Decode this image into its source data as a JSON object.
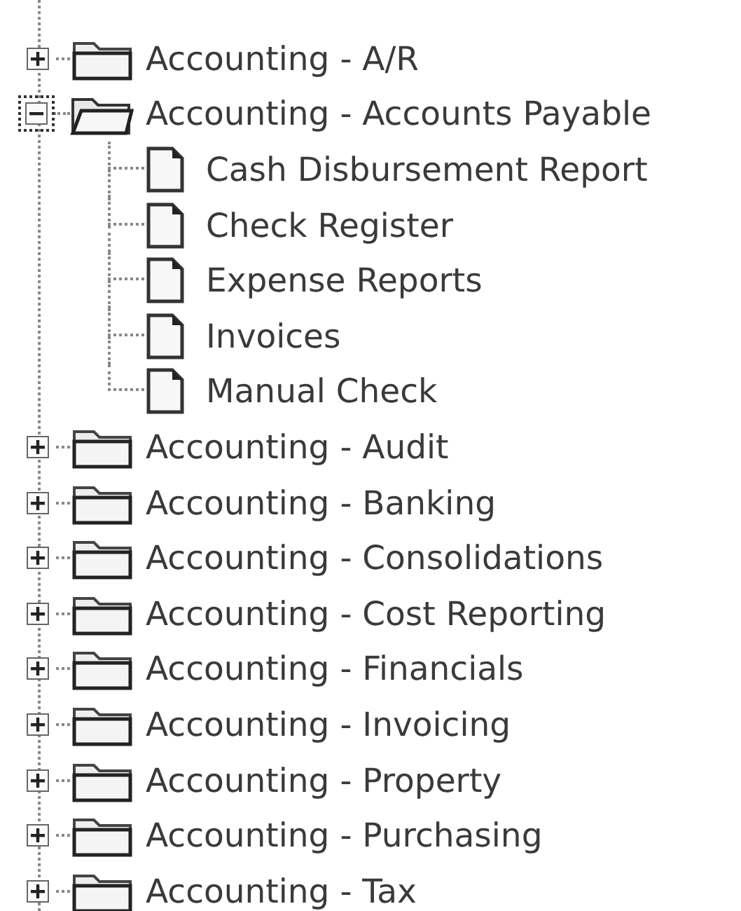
{
  "folders": [
    {
      "label": "Accounting - A/R",
      "expanded": false,
      "focused": false
    },
    {
      "label": "Accounting - Accounts Payable",
      "expanded": true,
      "focused": true,
      "children": [
        {
          "label": "Cash Disbursement Report"
        },
        {
          "label": "Check Register"
        },
        {
          "label": "Expense Reports"
        },
        {
          "label": "Invoices"
        },
        {
          "label": "Manual Check"
        }
      ]
    },
    {
      "label": "Accounting - Audit",
      "expanded": false,
      "focused": false
    },
    {
      "label": "Accounting - Banking",
      "expanded": false,
      "focused": false
    },
    {
      "label": "Accounting - Consolidations",
      "expanded": false,
      "focused": false
    },
    {
      "label": "Accounting - Cost Reporting",
      "expanded": false,
      "focused": false
    },
    {
      "label": "Accounting - Financials",
      "expanded": false,
      "focused": false
    },
    {
      "label": "Accounting - Invoicing",
      "expanded": false,
      "focused": false
    },
    {
      "label": "Accounting - Property",
      "expanded": false,
      "focused": false
    },
    {
      "label": "Accounting - Purchasing",
      "expanded": false,
      "focused": false
    },
    {
      "label": "Accounting - Tax",
      "expanded": false,
      "focused": false
    }
  ]
}
